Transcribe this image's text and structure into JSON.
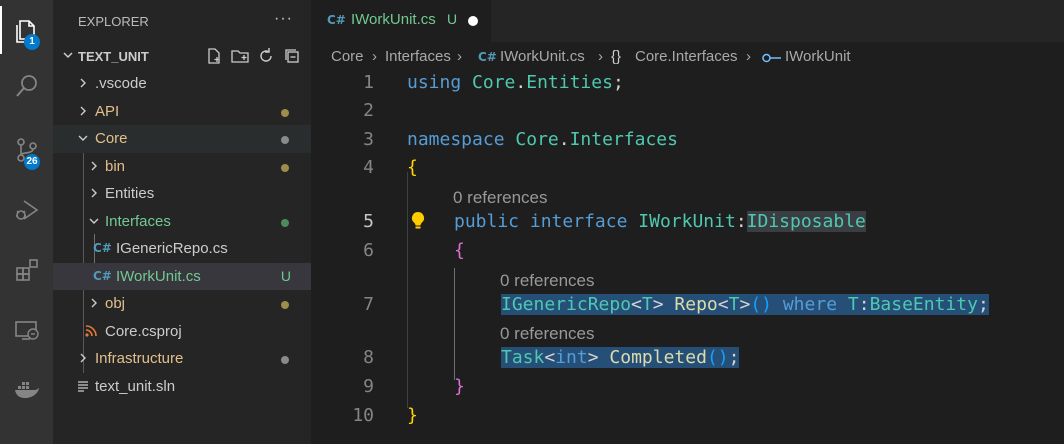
{
  "activity_bar": {
    "items": [
      {
        "icon": "files-icon",
        "badge": "1"
      },
      {
        "icon": "search-icon",
        "badge": ""
      },
      {
        "icon": "source-control-icon",
        "badge": "26"
      },
      {
        "icon": "run-debug-icon",
        "badge": ""
      },
      {
        "icon": "extensions-icon",
        "badge": ""
      },
      {
        "icon": "remote-explorer-icon",
        "badge": ""
      },
      {
        "icon": "docker-icon",
        "badge": ""
      }
    ]
  },
  "sidebar": {
    "title": "EXPLORER",
    "more": "···",
    "section_title": "TEXT_UNIT",
    "tree": [
      {
        "label": ".vscode",
        "color": "#cccccc"
      },
      {
        "label": "API",
        "color": "#e2c08d"
      },
      {
        "label": "Core",
        "color": "#e2c08d"
      },
      {
        "label": "bin",
        "color": "#e2c08d"
      },
      {
        "label": "Entities",
        "color": "#cccccc"
      },
      {
        "label": "Interfaces",
        "color": "#73c991"
      },
      {
        "label": "IGenericRepo.cs",
        "color": "#cccccc"
      },
      {
        "label": "IWorkUnit.cs",
        "color": "#73c991",
        "status": "U"
      },
      {
        "label": "obj",
        "color": "#e2c08d"
      },
      {
        "label": "Core.csproj",
        "color": "#cccccc"
      },
      {
        "label": "Infrastructure",
        "color": "#e2c08d"
      },
      {
        "label": "text_unit.sln",
        "color": "#cccccc"
      }
    ]
  },
  "tab": {
    "icon_text": "C#",
    "name": "IWorkUnit.cs",
    "status": "U"
  },
  "breadcrumb": {
    "items": [
      "Core",
      "Interfaces",
      "IWorkUnit.cs",
      "Core.Interfaces",
      "IWorkUnit"
    ],
    "separator": "›",
    "namespace_glyph": "{}",
    "cs_glyph": "C#"
  },
  "code": {
    "line_numbers": [
      "1",
      "2",
      "3",
      "4",
      "5",
      "6",
      "7",
      "8",
      "9",
      "10"
    ],
    "lens_text": "0 references",
    "l1": {
      "kw": "using",
      "ns1": "Core",
      "dot": ".",
      "ns2": "Entities",
      "semi": ";"
    },
    "l3": {
      "kw": "namespace",
      "ns1": "Core",
      "dot": ".",
      "ns2": "Interfaces"
    },
    "l4": {
      "brace": "{"
    },
    "l5": {
      "kw1": "public",
      "kw2": "interface",
      "name": "IWorkUnit",
      "colon": ":",
      "base": "IDisposable"
    },
    "l6": {
      "brace": "{"
    },
    "l7": {
      "t1": "IGenericRepo",
      "lt": "<",
      "T": "T",
      "gt": ">",
      "fn": "Repo",
      "lt2": "<",
      "T2": "T",
      "gt2": ">",
      "parens": "()",
      "kw": "where",
      "T3": "T",
      "colon": ":",
      "base": "BaseEntity",
      "semi": ";"
    },
    "l8": {
      "t1": "Task",
      "lt": "<",
      "kw": "int",
      "gt": ">",
      "fn": "Completed",
      "parens": "()",
      "semi": ";"
    },
    "l9": {
      "brace": "}"
    },
    "l10": {
      "brace": "}"
    }
  }
}
